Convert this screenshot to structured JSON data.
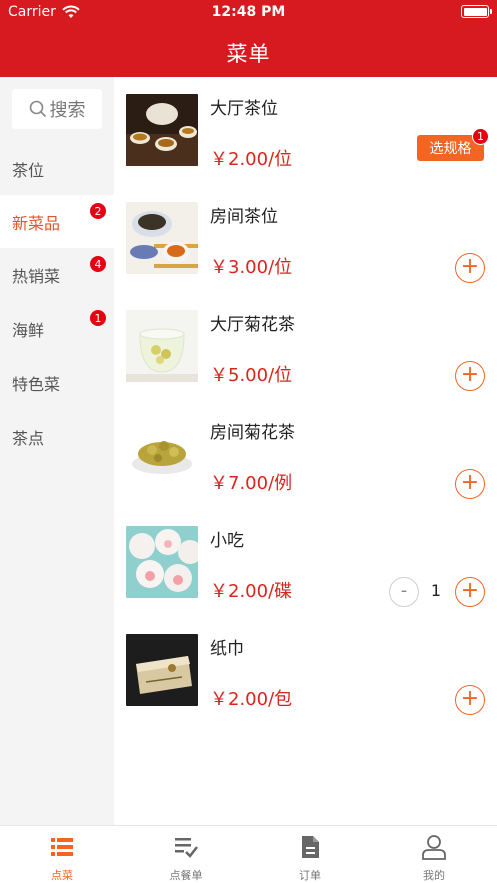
{
  "status_bar": {
    "carrier": "Carrier",
    "time": "12:48 PM"
  },
  "header": {
    "title": "菜单"
  },
  "search": {
    "label": "搜索"
  },
  "sidebar": {
    "items": [
      {
        "label": "茶位",
        "badge": null,
        "active": false
      },
      {
        "label": "新菜品",
        "badge": "2",
        "active": true
      },
      {
        "label": "热销菜",
        "badge": "4",
        "active": false
      },
      {
        "label": "海鲜",
        "badge": "1",
        "active": false
      },
      {
        "label": "特色菜",
        "badge": null,
        "active": false
      },
      {
        "label": "茶点",
        "badge": null,
        "active": false
      }
    ]
  },
  "dishes": [
    {
      "name": "大厅茶位",
      "price": "￥2.00/位",
      "action": "选规格",
      "action_badge": "1"
    },
    {
      "name": "房间茶位",
      "price": "￥3.00/位",
      "action": "+"
    },
    {
      "name": "大厅菊花茶",
      "price": "￥5.00/位",
      "action": "+"
    },
    {
      "name": "房间菊花茶",
      "price": "￥7.00/例",
      "action": "+"
    },
    {
      "name": "小吃",
      "price": "￥2.00/碟",
      "action": "+",
      "minus": "-",
      "quantity": "1"
    },
    {
      "name": "纸巾",
      "price": "￥2.00/包",
      "action": "+"
    }
  ],
  "tabbar": {
    "tabs": [
      {
        "label": "点菜",
        "icon": "list-icon",
        "active": true
      },
      {
        "label": "点餐单",
        "icon": "checklist-icon",
        "active": false
      },
      {
        "label": "订单",
        "icon": "document-icon",
        "active": false
      },
      {
        "label": "我的",
        "icon": "user-icon",
        "active": false
      }
    ]
  },
  "colors": {
    "header": "#d71920",
    "accent": "#f26522",
    "price": "#d9261c",
    "badge": "#e60012"
  }
}
